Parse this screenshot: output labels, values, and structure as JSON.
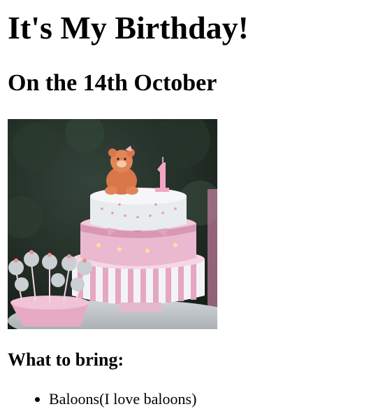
{
  "heading": "It's My Birthday!",
  "subheading": "On the 14th October",
  "image": {
    "alt": "Birthday cake with teddy bear",
    "icon": "birthday-cake-photo",
    "colors": {
      "background": "#1f2a22",
      "frosting_white": "#eef0f2",
      "frosting_pink": "#e8b6cc",
      "teddy": "#d9764a"
    }
  },
  "bring_heading": "What to bring:",
  "bring_items": [
    "Baloons(I love baloons)"
  ]
}
